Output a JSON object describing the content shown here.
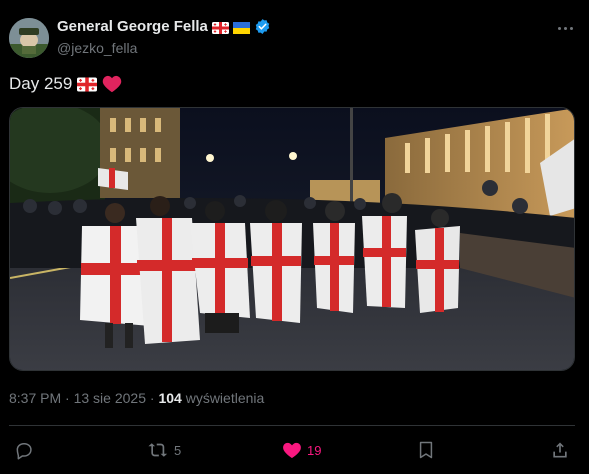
{
  "author": {
    "display_name": "General George Fella",
    "handle": "@jezko_fella",
    "avatar_icon": "avatar-image",
    "verified_icon": "verified-badge-icon",
    "name_flags": [
      "georgia-flag",
      "ukraine-flag"
    ]
  },
  "tweet": {
    "text": "Day 259",
    "emojis": [
      "georgia-flag",
      "red-heart"
    ]
  },
  "photo": {
    "description_icon": "protest-photo"
  },
  "meta": {
    "time": "8:37 PM",
    "separator": "·",
    "date": "13 sie 2025",
    "views_count": "104",
    "views_label": "wyświetlenia"
  },
  "actions": {
    "reply_count": "",
    "retweet_count": "5",
    "like_count": "19"
  },
  "colors": {
    "background": "#000000",
    "text": "#e7e9ea",
    "muted": "#71767b",
    "like": "#f91880",
    "verified": "#1d9bf0",
    "border": "#2f3336"
  }
}
